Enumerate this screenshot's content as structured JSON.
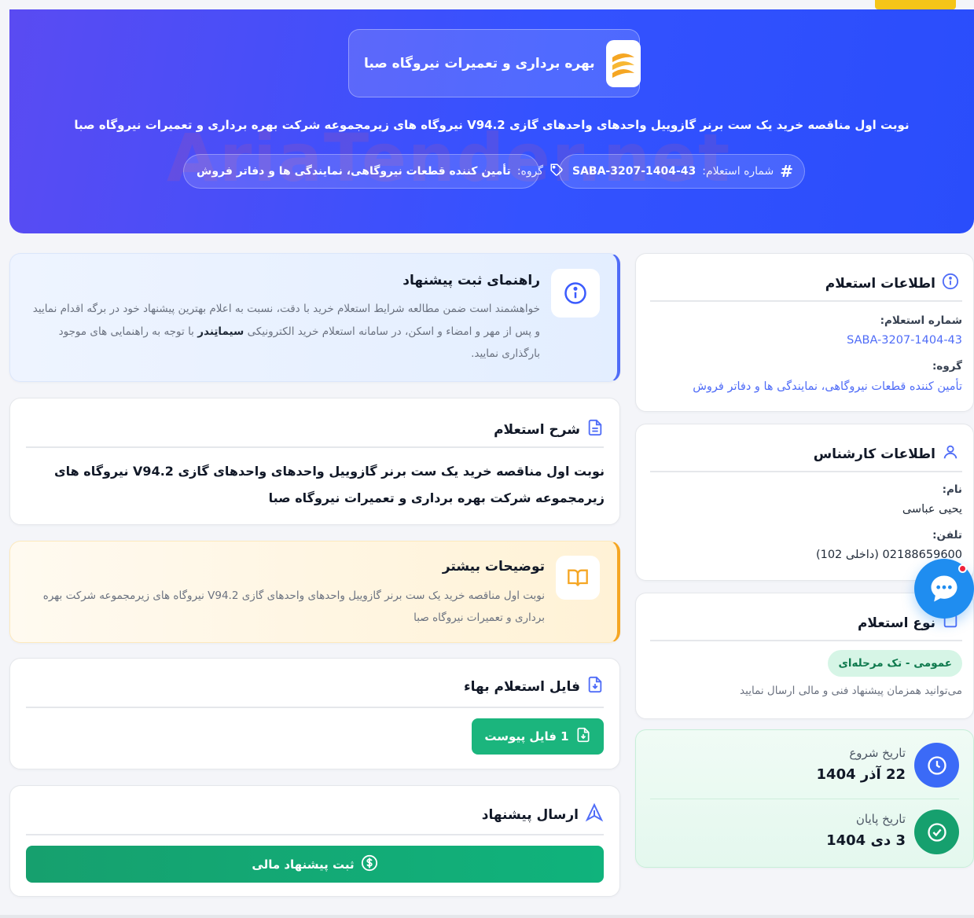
{
  "hero": {
    "org_name": "بهره برداری و تعمیرات نیروگاه صبا",
    "title": "نوبت اول مناقصه خرید یک ست برنر گازوییل واحدهای واحدهای گازی V94.2 نیروگاه های زیرمجموعه شرکت بهره برداری و تعمیرات نیروگاه صبا",
    "inquiry_label": "شماره استعلام:",
    "inquiry_value": "SABA-3207-1404-43",
    "group_label": "گروه:",
    "group_value": "تأمین کننده قطعات نیروگاهی، نمایندگی ها و دفاتر فروش",
    "watermark": "AriaTender.net"
  },
  "guide": {
    "title": "راهنمای ثبت پیشنهاد",
    "text_1": "خواهشمند است ضمن مطالعه شرایط استعلام خرید با دقت، نسبت به اعلام بهترین پیشنهاد خود در برگه اقدام نمایید و پس از مهر و امضاء و اسکن، در سامانه استعلام خرید الکترونیکی",
    "brand": "سیماتِندر",
    "text_2": "با توجه به راهنمایی های موجود بارگذاری نمایید."
  },
  "description": {
    "title": "شرح استعلام",
    "text": "نوبت اول مناقصه خرید یک ست برنر گازوییل واحدهای واحدهای گازی V94.2 نیروگاه های زیرمجموعه شرکت بهره برداری و تعمیرات نیروگاه صبا"
  },
  "more": {
    "title": "توضیحات بیشتر",
    "text": "نوبت اول مناقصه خرید یک ست برنر گازوییل واحدهای واحدهای گازی V94.2 نیروگاه های زیرمجموعه شرکت بهره برداری و تعمیرات نیروگاه صبا"
  },
  "file": {
    "title": "فایل استعلام بهاء",
    "button": "1 فایل پیوست"
  },
  "submit": {
    "title": "ارسال پیشنهاد",
    "button": "ثبت پیشنهاد مالی"
  },
  "info": {
    "title": "اطلاعات استعلام",
    "number_label": "شماره استعلام:",
    "number_value": "SABA-3207-1404-43",
    "group_label": "گروه:",
    "group_value": "تأمین کننده قطعات نیروگاهی، نمایندگی ها و دفاتر فروش"
  },
  "expert": {
    "title": "اطلاعات کارشناس",
    "name_label": "نام:",
    "name_value": "یحیی عباسی",
    "phone_label": "تلفن:",
    "phone_value": "02188659600 (داخلی 102)"
  },
  "type": {
    "title": "نوع استعلام",
    "badge": "عمومی - تک مرحله‌ای",
    "note": "می‌توانید همزمان پیشنهاد فنی و مالی ارسال نمایید"
  },
  "dates": {
    "start_label": "تاریخ شروع",
    "start_value": "22 آذر 1404",
    "end_label": "تاریخ پایان",
    "end_value": "3 دی 1404"
  },
  "colors": {
    "primary": "#3452ff",
    "success": "#1bb57d",
    "warning": "#f5a623",
    "accent": "#f5c518"
  }
}
